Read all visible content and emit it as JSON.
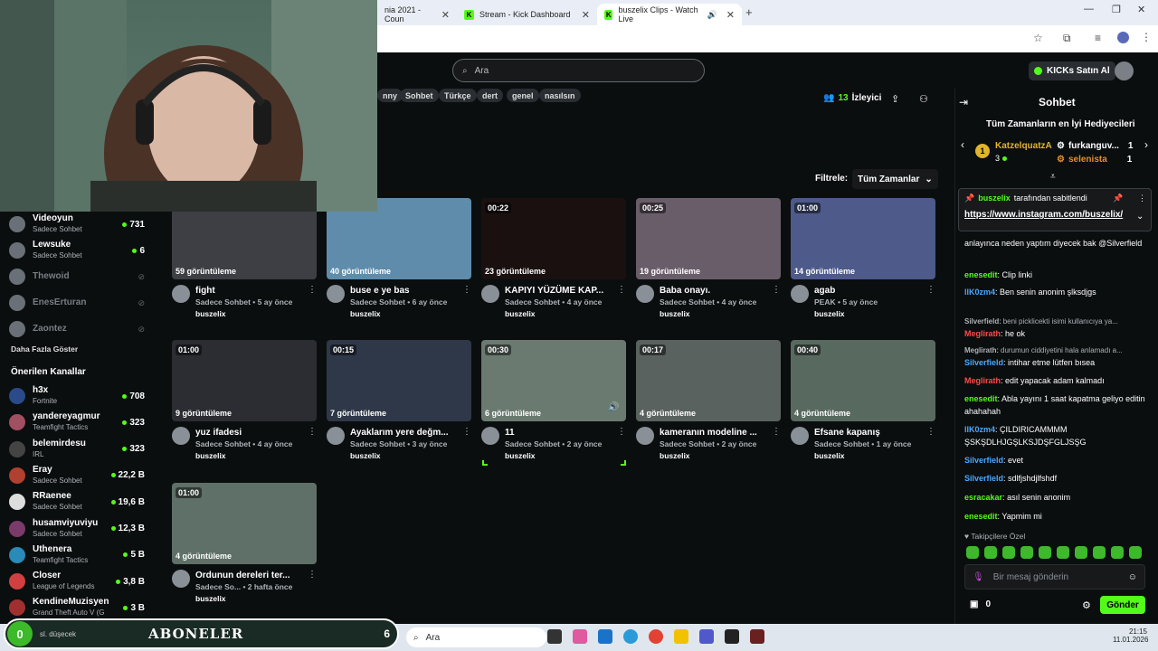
{
  "browser": {
    "tabs": [
      {
        "label": "nia 2021 - Coun",
        "active": false
      },
      {
        "label": "Stream - Kick Dashboard",
        "active": false
      },
      {
        "label": "buszelix Clips - Watch Live",
        "active": true
      }
    ],
    "new_tab": "+"
  },
  "header": {
    "search_placeholder": "Ara",
    "kicks_label": "KICKs Satın Al"
  },
  "tags": [
    "nny",
    "Sohbet",
    "Türkçe",
    "dert",
    "genel",
    "nasılsın"
  ],
  "channel": {
    "viewers_count": "13",
    "viewers_label": "İzleyici"
  },
  "filter": {
    "label": "Filtrele:",
    "value": "Tüm Zamanlar"
  },
  "sidebar": {
    "followed": [
      {
        "name": "Videoyun",
        "sub": "Sadece Sohbet",
        "count": "731",
        "live": true
      },
      {
        "name": "Lewsuke",
        "sub": "Sadece Sohbet",
        "count": "6",
        "live": true
      },
      {
        "name": "Thewoid",
        "sub": "",
        "count": "",
        "live": false
      },
      {
        "name": "EnesErturan",
        "sub": "",
        "count": "",
        "live": false
      },
      {
        "name": "Zaontez",
        "sub": "",
        "count": "",
        "live": false
      }
    ],
    "show_more": "Daha Fazla Göster",
    "recommended_title": "Önerilen Kanallar",
    "recommended": [
      {
        "name": "h3x",
        "sub": "Fortnite",
        "count": "708"
      },
      {
        "name": "yandereyagmur",
        "sub": "Teamfight Tactics",
        "count": "323"
      },
      {
        "name": "belemirdesu",
        "sub": "IRL",
        "count": "323"
      },
      {
        "name": "Eray",
        "sub": "Sadece Sohbet",
        "count": "22,2 B"
      },
      {
        "name": "RRaenee",
        "sub": "Sadece Sohbet",
        "count": "19,6 B"
      },
      {
        "name": "husamviyuviyu",
        "sub": "Sadece Sohbet",
        "count": "12,3 B"
      },
      {
        "name": "Uthenera",
        "sub": "Teamfight Tactics",
        "count": "5 B"
      },
      {
        "name": "Closer",
        "sub": "League of Legends",
        "count": "3,8 B"
      },
      {
        "name": "KendineMuzisyen",
        "sub": "Grand Theft Auto V (G",
        "count": "3 B"
      }
    ]
  },
  "clips": [
    {
      "duration": "",
      "views": "59 görüntüleme",
      "title": "fight",
      "meta": "Sadece Sohbet • 5 ay önce",
      "user": "buszelix",
      "color": "#3d3f44"
    },
    {
      "duration": "",
      "views": "40 görüntüleme",
      "title": "buse e ye bas",
      "meta": "Sadece Sohbet • 6 ay önce",
      "user": "buszelix",
      "color": "#5f8cab"
    },
    {
      "duration": "00:22",
      "views": "23 görüntüleme",
      "title": "KAPIYI YÜZÜME KAP...",
      "meta": "Sadece Sohbet • 4 ay önce",
      "user": "buszelix",
      "color": "#1a1010"
    },
    {
      "duration": "00:25",
      "views": "19 görüntüleme",
      "title": "Baba onayı.",
      "meta": "Sadece Sohbet • 4 ay önce",
      "user": "buszelix",
      "color": "#6a5d6a"
    },
    {
      "duration": "01:00",
      "views": "14 görüntüleme",
      "title": "agab",
      "meta": "PEAK • 5 ay önce",
      "user": "buszelix",
      "color": "#4d5a8a"
    },
    {
      "duration": "01:00",
      "views": "9 görüntüleme",
      "title": "yuz ifadesi",
      "meta": "Sadece Sohbet • 4 ay önce",
      "user": "buszelix",
      "color": "#2b2d33"
    },
    {
      "duration": "00:15",
      "views": "7 görüntüleme",
      "title": "Ayaklarım yere değm...",
      "meta": "Sadece Sohbet • 3 ay önce",
      "user": "buszelix",
      "color": "#2f3848"
    },
    {
      "duration": "00:30",
      "views": "6 görüntüleme",
      "title": "11",
      "meta": "Sadece Sohbet • 2 ay önce",
      "user": "buszelix",
      "color": "#6a7a70"
    },
    {
      "duration": "00:17",
      "views": "4 görüntüleme",
      "title": "kameranın modeline ...",
      "meta": "Sadece Sohbet • 2 ay önce",
      "user": "buszelix",
      "color": "#5a625f"
    },
    {
      "duration": "00:40",
      "views": "4 görüntüleme",
      "title": "Efsane kapanış",
      "meta": "Sadece Sohbet • 1 ay önce",
      "user": "buszelix",
      "color": "#586a60"
    },
    {
      "duration": "01:00",
      "views": "4 görüntüleme",
      "title": "Ordunun dereleri ter...",
      "meta": "Sadece So... • 2 hafta önce",
      "user": "buszelix",
      "color": "#5e7067"
    }
  ],
  "chat": {
    "title": "Sohbet",
    "top_gifters_title": "Tüm Zamanların en İyi Hediyecileri",
    "gifters": [
      {
        "name": "KatzelquatzA",
        "count": "3"
      },
      {
        "name": "furkanguv...",
        "count": "1"
      },
      {
        "name": "selenista",
        "count": "1"
      }
    ],
    "pinned_by": "buszelix",
    "pinned_label": "tarafından sabitlendi",
    "pinned_link": "https://www.instagram.com/buszelix/",
    "messages": [
      {
        "user": "",
        "text": "anlayınca neden yaptım diyecek bak @Silverfield",
        "color": "#ffffff"
      },
      {
        "user": "enesedit",
        "text": "Clip linki",
        "color": "#53fc18"
      },
      {
        "user": "llK0zm4",
        "text": "Ben senin anonim şlksdjgs",
        "color": "#4aa8ff"
      },
      {
        "user": "Silverfield",
        "text": "beni picklicekti isimi kullanıcıya ya...",
        "color": "#adb2b7"
      },
      {
        "user": "Meglirath",
        "text": "he ok",
        "color": "#ff4a4a"
      },
      {
        "user": "Meglirath",
        "text": "durumun ciddiyetini hala anlamadı a...",
        "color": "#adb2b7"
      },
      {
        "user": "Silverfield",
        "text": "intihar etme lütfen bısea",
        "color": "#4aa8ff"
      },
      {
        "user": "Meglirath",
        "text": "edit yapacak adam kalmadı",
        "color": "#ff4a4a"
      },
      {
        "user": "enesedit",
        "text": "Abla yayını 1 saat kapatma geliyo editin ahahahah",
        "color": "#53fc18"
      },
      {
        "user": "llK0zm4",
        "text": "ÇILDIRICAMMMM ŞSKŞDLHJGŞLKSJDŞFGLJSŞG",
        "color": "#4aa8ff"
      },
      {
        "user": "Silverfield",
        "text": "evet",
        "color": "#4aa8ff"
      },
      {
        "user": "Silverfield",
        "text": "sdlfjshdjlfshdf",
        "color": "#4aa8ff"
      },
      {
        "user": "esracakar",
        "text": "asıl senin anonim",
        "color": "#53fc18"
      },
      {
        "user": "enesedit",
        "text": "Yapmim mi",
        "color": "#53fc18"
      }
    ],
    "followers_only": "Takipçilere Özel",
    "input_placeholder": "Bir mesaj gönderin",
    "points": "0",
    "send_label": "Gönder"
  },
  "overlay": {
    "aboneler_title": "ABONELER",
    "aboneler_count": "0",
    "aboneler_right": "6",
    "aboneler_sub": "sl. düşecek"
  },
  "taskbar": {
    "search": "Ara",
    "time": "21:15",
    "date": "11.01.2026"
  }
}
